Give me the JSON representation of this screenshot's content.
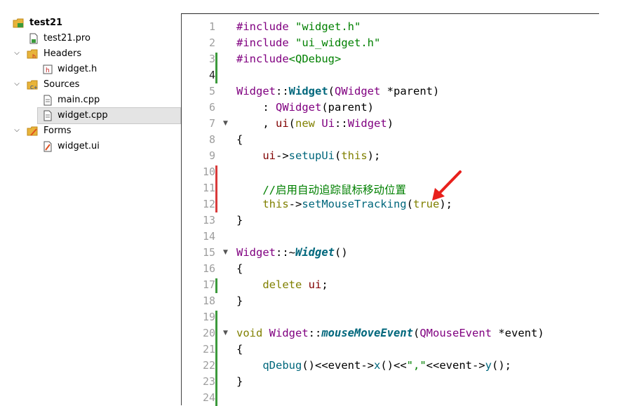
{
  "project_tree": {
    "project": "test21",
    "items": [
      {
        "label": "test21.pro",
        "icon": "pro-file-icon"
      },
      {
        "label": "Headers",
        "icon": "headers-folder-icon"
      },
      {
        "label": "widget.h",
        "icon": "header-file-icon"
      },
      {
        "label": "Sources",
        "icon": "sources-folder-icon"
      },
      {
        "label": "main.cpp",
        "icon": "cpp-file-icon"
      },
      {
        "label": "widget.cpp",
        "icon": "cpp-file-icon",
        "selected": true
      },
      {
        "label": "Forms",
        "icon": "forms-folder-icon"
      },
      {
        "label": "widget.ui",
        "icon": "ui-file-icon"
      }
    ]
  },
  "editor": {
    "line_numbers": [
      "1",
      "2",
      "3",
      "4",
      "5",
      "6",
      "7",
      "8",
      "9",
      "10",
      "11",
      "12",
      "13",
      "14",
      "15",
      "16",
      "17",
      "18",
      "19",
      "20",
      "21",
      "22",
      "23",
      "24"
    ],
    "current_line": "4",
    "lines": [
      {
        "parts": [
          {
            "t": "#include ",
            "c": "ty"
          },
          {
            "t": "\"widget.h\"",
            "c": "str"
          }
        ]
      },
      {
        "parts": [
          {
            "t": "#include ",
            "c": "ty"
          },
          {
            "t": "\"ui_widget.h\"",
            "c": "str"
          }
        ]
      },
      {
        "parts": [
          {
            "t": "#include",
            "c": "ty"
          },
          {
            "t": "<QDebug>",
            "c": "str"
          }
        ]
      },
      {
        "parts": []
      },
      {
        "parts": [
          {
            "t": "Widget",
            "c": "cls"
          },
          {
            "t": "::",
            "c": ""
          },
          {
            "t": "Widget",
            "c": "fnb"
          },
          {
            "t": "(",
            "c": ""
          },
          {
            "t": "QWidget",
            "c": "cls"
          },
          {
            "t": " *parent)",
            "c": ""
          }
        ]
      },
      {
        "parts": [
          {
            "t": "    : ",
            "c": ""
          },
          {
            "t": "QWidget",
            "c": "cls"
          },
          {
            "t": "(parent)",
            "c": ""
          }
        ]
      },
      {
        "parts": [
          {
            "t": "    , ",
            "c": ""
          },
          {
            "t": "ui",
            "c": "mem"
          },
          {
            "t": "(",
            "c": ""
          },
          {
            "t": "new",
            "c": "kw"
          },
          {
            "t": " ",
            "c": ""
          },
          {
            "t": "Ui",
            "c": "cls"
          },
          {
            "t": "::",
            "c": ""
          },
          {
            "t": "Widget",
            "c": "cls"
          },
          {
            "t": ")",
            "c": ""
          }
        ]
      },
      {
        "parts": [
          {
            "t": "{",
            "c": ""
          }
        ]
      },
      {
        "parts": [
          {
            "t": "    ",
            "c": ""
          },
          {
            "t": "ui",
            "c": "mem"
          },
          {
            "t": "->",
            "c": ""
          },
          {
            "t": "setupUi",
            "c": "fn"
          },
          {
            "t": "(",
            "c": ""
          },
          {
            "t": "this",
            "c": "kw"
          },
          {
            "t": ");",
            "c": ""
          }
        ]
      },
      {
        "parts": []
      },
      {
        "parts": [
          {
            "t": "    //启用自动追踪鼠标移动位置",
            "c": "cm"
          }
        ]
      },
      {
        "parts": [
          {
            "t": "    ",
            "c": ""
          },
          {
            "t": "this",
            "c": "kw"
          },
          {
            "t": "->",
            "c": ""
          },
          {
            "t": "setMouseTracking",
            "c": "fn"
          },
          {
            "t": "(",
            "c": ""
          },
          {
            "t": "true",
            "c": "kw"
          },
          {
            "t": ");",
            "c": ""
          }
        ]
      },
      {
        "parts": [
          {
            "t": "}",
            "c": ""
          }
        ]
      },
      {
        "parts": []
      },
      {
        "parts": [
          {
            "t": "Widget",
            "c": "cls"
          },
          {
            "t": "::~",
            "c": ""
          },
          {
            "t": "Widget",
            "c": "fnbi"
          },
          {
            "t": "()",
            "c": ""
          }
        ]
      },
      {
        "parts": [
          {
            "t": "{",
            "c": ""
          }
        ]
      },
      {
        "parts": [
          {
            "t": "    ",
            "c": ""
          },
          {
            "t": "delete",
            "c": "kw"
          },
          {
            "t": " ",
            "c": ""
          },
          {
            "t": "ui",
            "c": "mem"
          },
          {
            "t": ";",
            "c": ""
          }
        ]
      },
      {
        "parts": [
          {
            "t": "}",
            "c": ""
          }
        ]
      },
      {
        "parts": []
      },
      {
        "parts": [
          {
            "t": "void",
            "c": "kw"
          },
          {
            "t": " ",
            "c": ""
          },
          {
            "t": "Widget",
            "c": "cls"
          },
          {
            "t": "::",
            "c": ""
          },
          {
            "t": "mouseMoveEvent",
            "c": "fnbi"
          },
          {
            "t": "(",
            "c": ""
          },
          {
            "t": "QMouseEvent",
            "c": "cls"
          },
          {
            "t": " *event)",
            "c": ""
          }
        ]
      },
      {
        "parts": [
          {
            "t": "{",
            "c": ""
          }
        ]
      },
      {
        "parts": [
          {
            "t": "    ",
            "c": ""
          },
          {
            "t": "qDebug",
            "c": "fn"
          },
          {
            "t": "()<<event->",
            "c": ""
          },
          {
            "t": "x",
            "c": "fn"
          },
          {
            "t": "()<<",
            "c": ""
          },
          {
            "t": "\",\"",
            "c": "str"
          },
          {
            "t": "<<event->",
            "c": ""
          },
          {
            "t": "y",
            "c": "fn"
          },
          {
            "t": "();",
            "c": ""
          }
        ]
      },
      {
        "parts": [
          {
            "t": "}",
            "c": ""
          }
        ]
      },
      {
        "parts": []
      }
    ]
  },
  "colors": {
    "added_marker": "#3c9a3c",
    "modified_marker": "#d93b3b",
    "annotation_arrow": "#e8201c"
  }
}
